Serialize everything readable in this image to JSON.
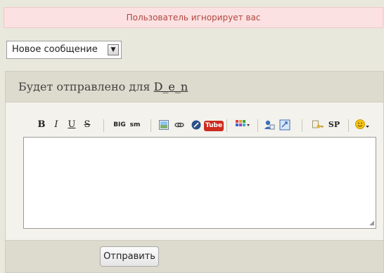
{
  "alert": {
    "text": "Пользователь игнорирует вас"
  },
  "message_type": {
    "selected": "Новое сообщение"
  },
  "compose": {
    "title_prefix": "Будет отправлено для",
    "recipient": "D_e_n",
    "send_label": "Отправить"
  },
  "toolbar": {
    "bold": "B",
    "italic": "I",
    "underline": "U",
    "strike": "S",
    "big": "BIG",
    "small": "sm",
    "youtube": "Tube",
    "spoiler": "SP"
  },
  "colors": {
    "background": "#e9e8dd",
    "alert_bg": "#fbe1e1",
    "alert_text": "#b3463f",
    "panel_header": "#dcdbcd",
    "youtube_red": "#cc2b1f"
  }
}
